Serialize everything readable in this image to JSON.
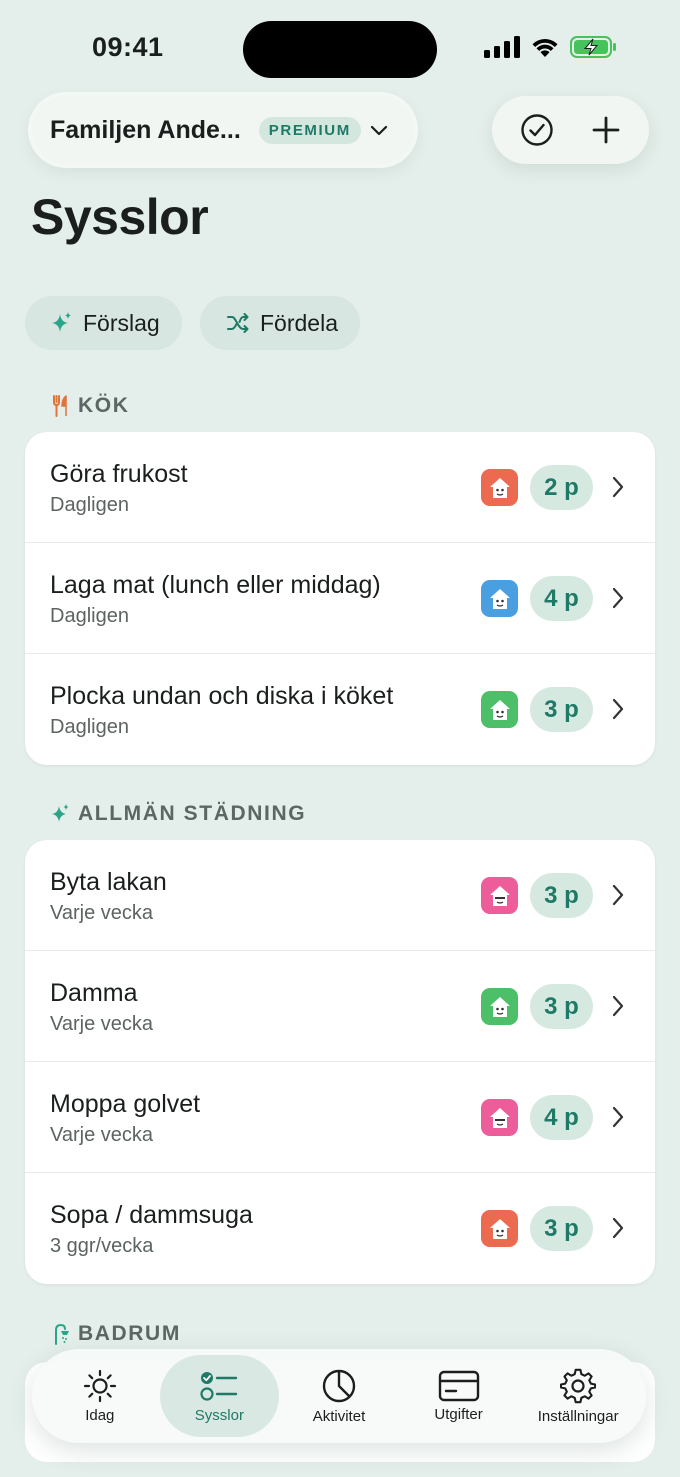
{
  "status": {
    "time": "09:41"
  },
  "header": {
    "family_name": "Familjen Ande...",
    "badge": "PREMIUM",
    "title": "Sysslor"
  },
  "chips": [
    {
      "label": "Förslag",
      "icon": "sparkle-icon"
    },
    {
      "label": "Fördela",
      "icon": "shuffle-icon"
    }
  ],
  "sections": [
    {
      "title": "KÖK",
      "icon": "fork-knife-icon",
      "rows": [
        {
          "title": "Göra frukost",
          "sub": "Dagligen",
          "points": "2 p",
          "avatar_color": "#ec6a4f"
        },
        {
          "title": "Laga mat (lunch eller middag)",
          "sub": "Dagligen",
          "points": "4 p",
          "avatar_color": "#4a9fe0"
        },
        {
          "title": "Plocka undan och diska i köket",
          "sub": "Dagligen",
          "points": "3 p",
          "avatar_color": "#4dbf68"
        }
      ]
    },
    {
      "title": "ALLMÄN STÄDNING",
      "icon": "sparkle-icon",
      "rows": [
        {
          "title": "Byta lakan",
          "sub": "Varje vecka",
          "points": "3 p",
          "avatar_color": "#ec5d9a"
        },
        {
          "title": "Damma",
          "sub": "Varje vecka",
          "points": "3 p",
          "avatar_color": "#4dbf68"
        },
        {
          "title": "Moppa golvet",
          "sub": "Varje vecka",
          "points": "4 p",
          "avatar_color": "#ec5d9a"
        },
        {
          "title": "Sopa / dammsuga",
          "sub": "3 ggr/vecka",
          "points": "3 p",
          "avatar_color": "#ec6a4f"
        }
      ]
    },
    {
      "title": "BADRUM",
      "icon": "shower-icon",
      "rows": []
    }
  ],
  "tabs": [
    {
      "label": "Idag",
      "icon": "sun-icon"
    },
    {
      "label": "Sysslor",
      "icon": "checklist-icon",
      "active": true
    },
    {
      "label": "Aktivitet",
      "icon": "pie-chart-icon"
    },
    {
      "label": "Utgifter",
      "icon": "card-icon"
    },
    {
      "label": "Inställningar",
      "icon": "gear-icon"
    }
  ],
  "colors": {
    "accent": "#1e7a66",
    "background": "#e4eeea",
    "kitchen_icon": "#e0743a",
    "sparkle": "#2aa58a",
    "shower": "#2aa58a"
  }
}
